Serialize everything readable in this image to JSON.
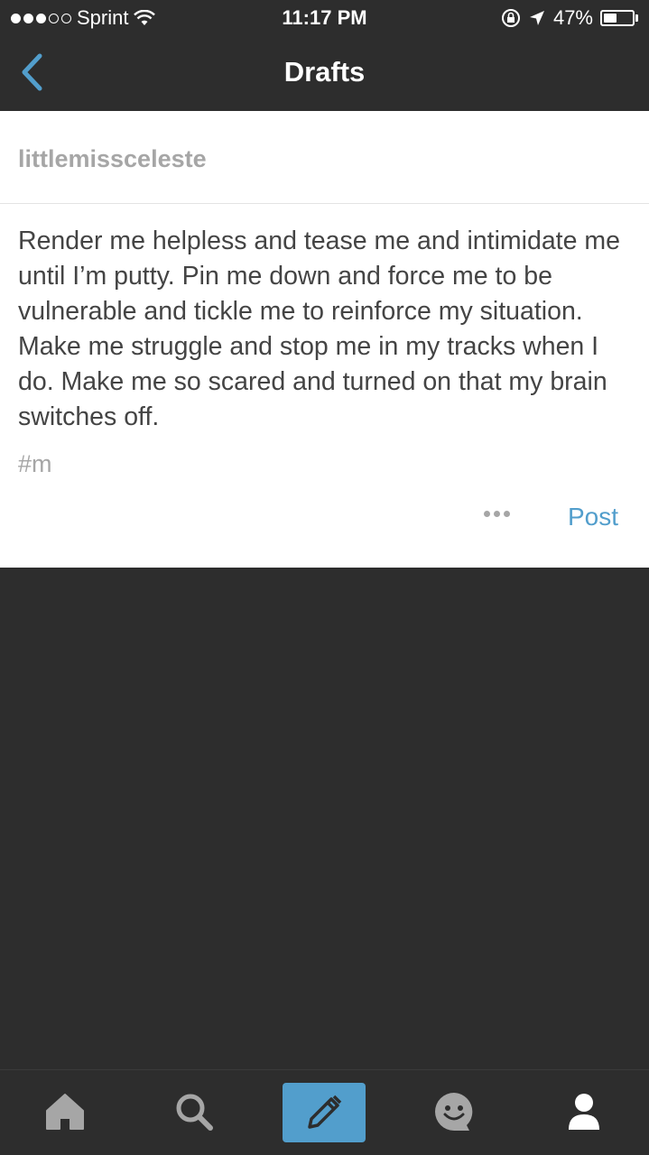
{
  "status_bar": {
    "carrier": "Sprint",
    "time": "11:17 PM",
    "battery_text": "47%",
    "battery_level": 0.47,
    "signal_bars_filled": 3,
    "signal_bars_total": 5
  },
  "nav": {
    "title": "Drafts",
    "back_icon": "chevron-left-icon",
    "accent_color": "#529ecc"
  },
  "draft": {
    "blog_name": "littlemissceleste",
    "body": "Render me helpless and tease me and intimidate me until I’m putty. Pin me down and force me to be vulnerable and tickle me to reinforce my situation. Make me struggle and stop me in my tracks when I do. Make me so scared and turned on that my brain switches off.",
    "tag": "#m",
    "post_label": "Post",
    "more_icon": "more-options-icon"
  },
  "tab_bar": {
    "tabs": [
      {
        "name": "home",
        "icon": "home-icon"
      },
      {
        "name": "search",
        "icon": "search-icon"
      },
      {
        "name": "compose",
        "icon": "pencil-icon"
      },
      {
        "name": "activity",
        "icon": "smiley-chat-icon"
      },
      {
        "name": "account",
        "icon": "user-icon"
      }
    ]
  },
  "colors": {
    "background": "#2d2d2d",
    "card": "#ffffff",
    "accent": "#529ecc",
    "muted_text": "#a6a6a6",
    "icon_gray": "#a6a6a6"
  }
}
